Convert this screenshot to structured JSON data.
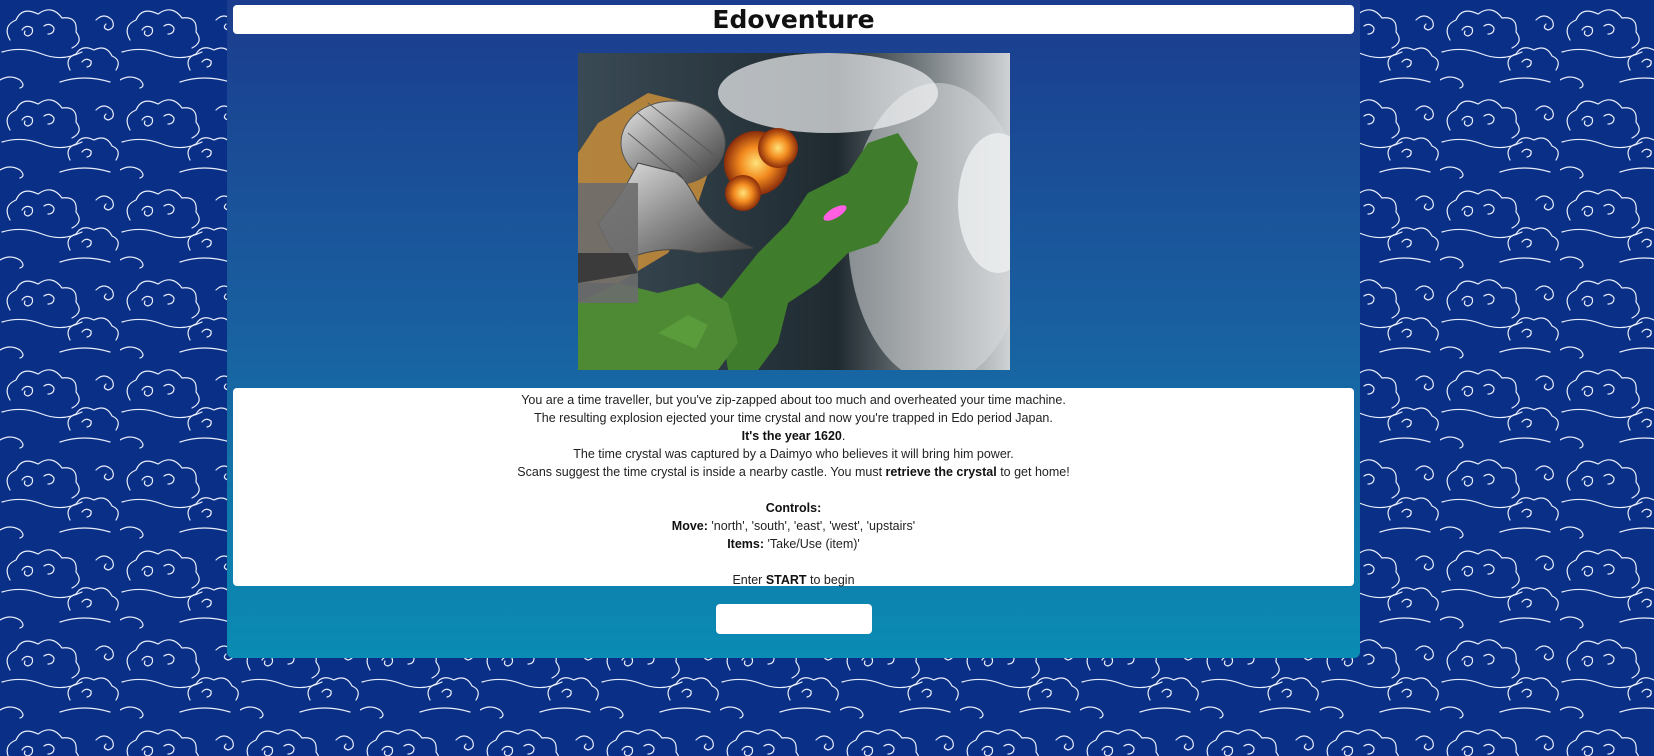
{
  "page": {
    "title": "Edoventure"
  },
  "hero_image": {
    "description_icon": "spaceship-over-japan-image"
  },
  "story": {
    "line1": "You are a time traveller, but you've zip-zapped about too much and overheated your time machine.",
    "line2": "The resulting explosion ejected your time crystal and now you're trapped in Edo period Japan.",
    "line3_bold": "It's the year 1620",
    "line3_tail": ".",
    "line4": "The time crystal was captured by a Daimyo who believes it will bring him power.",
    "line5_pre": "Scans suggest the time crystal is inside a nearby castle. You must ",
    "line5_bold": "retrieve the crystal",
    "line5_post": " to get home!",
    "controls_heading": "Controls:",
    "move_label": "Move:",
    "move_value": " 'north', 'south', 'east', 'west', 'upstairs'",
    "items_label": "Items:",
    "items_value": " 'Take/Use (item)'",
    "enter_pre": "Enter ",
    "enter_bold": "START",
    "enter_post": " to begin"
  },
  "command": {
    "value": "",
    "placeholder": ""
  },
  "colors": {
    "page_bg": "#0a2f86",
    "panel_top": "#1b3c8e",
    "panel_bottom": "#0a8cb4"
  }
}
